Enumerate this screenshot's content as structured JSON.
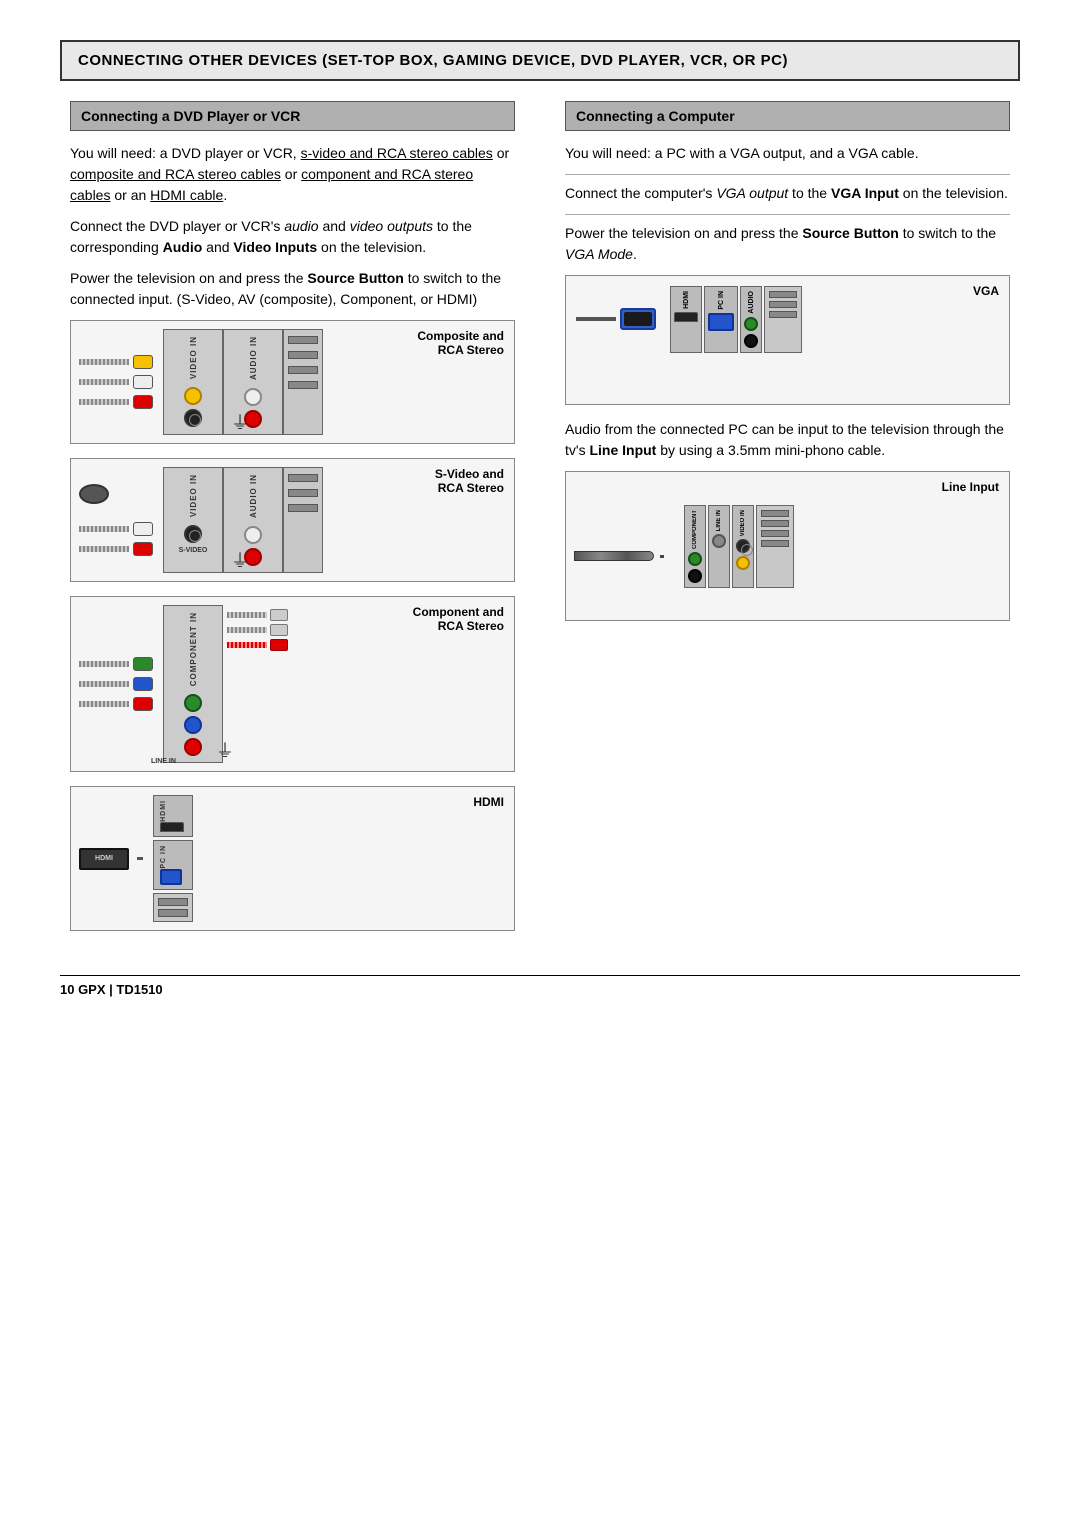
{
  "page": {
    "main_title": "CONNECTING OTHER DEVICES (SET-TOP BOX, GAMING DEVICE, DVD PLAYER, VCR, OR PC)",
    "left_section_title": "Connecting a DVD Player or VCR",
    "right_section_title": "Connecting a Computer",
    "left_para1": "You will need: a DVD player or VCR, s-video and RCA stereo cables or composite and RCA stereo cables or component and RCA stereo cables or an HDMI cable.",
    "left_para2_pre": "Connect the DVD player or VCR's ",
    "left_para2_italic1": "audio",
    "left_para2_mid": " and ",
    "left_para2_italic2": "video outputs",
    "left_para2_post": " to the corresponding ",
    "left_para2_bold1": "Audio",
    "left_para2_mid2": " and ",
    "left_para2_bold2": "Video Inputs",
    "left_para2_end": " on the television.",
    "left_para3_pre": "Power the television on and press the ",
    "left_para3_bold1": "Source Button",
    "left_para3_post": " to switch to the connected input. (S-Video, AV (composite), Component, or HDMI)",
    "right_para1": "You will need: a PC with a VGA output, and a VGA cable.",
    "right_para2_pre": "Connect the computer's ",
    "right_para2_italic": "VGA output",
    "right_para2_mid": " to the ",
    "right_para2_bold": "VGA Input",
    "right_para2_end": " on the television.",
    "right_para3_pre": "Power the television on and press the ",
    "right_para3_bold1": "Source Button",
    "right_para3_post": " to switch to the ",
    "right_para3_italic": "VGA Mode",
    "right_para3_end": ".",
    "right_para4_pre": "Audio from the connected PC can be input to the television through the tv's ",
    "right_para4_bold": "Line Input",
    "right_para4_post": " by using a 3.5mm mini-phono cable.",
    "diagram1_label": "Composite and\nRCA Stereo",
    "diagram2_label": "S-Video and\nRCA Stereo",
    "diagram3_label": "Component and\nRCA Stereo",
    "diagram4_label": "HDMI",
    "diagram5_label": "VGA",
    "diagram6_label": "Line Input",
    "footer_text": "10   GPX  |  TD1510",
    "labels": {
      "video_in": "VIDEO IN",
      "audio_in": "AUDIO IN",
      "svideo": "S-VIDEO",
      "component_in": "COMPONENT IN",
      "line_in": "LINE IN",
      "hdmi": "HDMI",
      "pcin": "PC IN",
      "vga": "VGA"
    }
  }
}
